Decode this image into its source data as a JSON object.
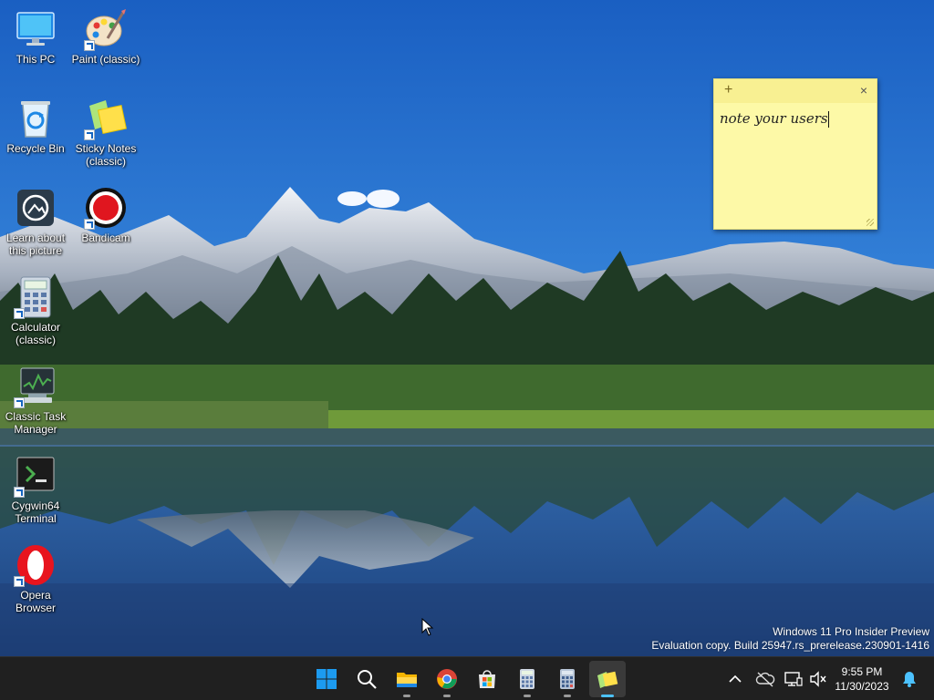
{
  "desktop": {
    "icons": [
      {
        "label": "This PC",
        "icon": "computer-monitor-icon"
      },
      {
        "label": "Paint (classic)",
        "icon": "paint-palette-icon"
      },
      {
        "label": "Recycle Bin",
        "icon": "recycle-bin-icon"
      },
      {
        "label": "Sticky Notes (classic)",
        "icon": "sticky-notes-icon"
      },
      {
        "label": "Learn about this picture",
        "icon": "camera-icon"
      },
      {
        "label": "Bandicam",
        "icon": "record-icon"
      },
      {
        "label": "Calculator (classic)",
        "icon": "calculator-icon"
      },
      {
        "label": "Classic Task Manager",
        "icon": "task-manager-icon"
      },
      {
        "label": "Cygwin64 Terminal",
        "icon": "terminal-icon"
      },
      {
        "label": "Opera Browser",
        "icon": "opera-icon"
      }
    ]
  },
  "sticky_note": {
    "text": "note your users",
    "add_glyph": "+",
    "close_glyph": "×",
    "color": "#fdf9a7"
  },
  "watermark": {
    "line1": "Windows 11 Pro Insider Preview",
    "line2": "Evaluation copy. Build 25947.rs_prerelease.230901-1416"
  },
  "taskbar": {
    "apps": [
      {
        "icon": "windows-start-icon"
      },
      {
        "icon": "search-icon"
      },
      {
        "icon": "file-explorer-icon"
      },
      {
        "icon": "chrome-icon"
      },
      {
        "icon": "microsoft-store-icon"
      },
      {
        "icon": "calculator-icon"
      },
      {
        "icon": "calculator-classic-icon"
      },
      {
        "icon": "sticky-notes-icon"
      }
    ],
    "tray": {
      "clock_time": "9:55 PM",
      "clock_date": "11/30/2023"
    },
    "background": "#202020",
    "accent": "#4cc2ff"
  }
}
